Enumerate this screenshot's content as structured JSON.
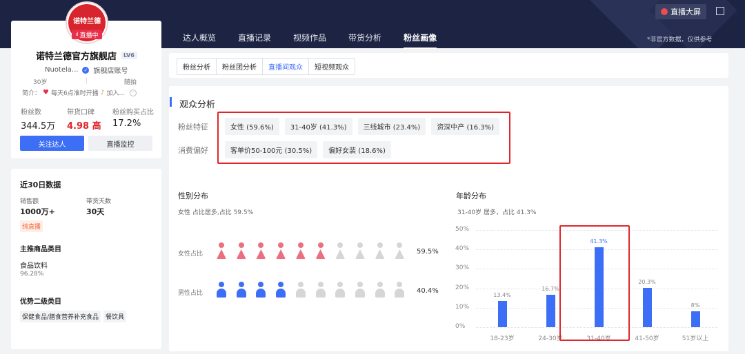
{
  "colors": {
    "primary": "#3d6ef6",
    "female": "#ec6f80",
    "male": "#3d6ef6",
    "inactive": "#d6d6d6",
    "highlight": "#e0262a"
  },
  "header": {
    "nav": [
      "达人概览",
      "直播记录",
      "视频作品",
      "带货分析",
      "粉丝画像"
    ],
    "active_nav": "粉丝画像",
    "live_screen_btn": "直播大屏",
    "disclaimer": "*非官方数据，仅供参考"
  },
  "profile": {
    "logo_text": "诺特兰德",
    "live_badge": "直播中",
    "name": "诺特兰德官方旗舰店",
    "level": "LV6",
    "handle": "Nuotela...",
    "verified": "旗舰店账号",
    "age": "30岁",
    "random": "随拍",
    "intro_label": "简介：",
    "intro_text": "每天6点准时开播",
    "intro_more": "加入...",
    "stats": [
      {
        "label": "粉丝数",
        "value": "344.5万"
      },
      {
        "label": "带货口碑",
        "value": "4.98 高"
      },
      {
        "label": "粉丝购买占比",
        "value": "17.2%"
      }
    ],
    "follow_btn": "关注达人",
    "monitor_btn": "直播监控"
  },
  "recent": {
    "title": "近30日数据",
    "sales_label": "销售额",
    "sales_value": "1000万+",
    "days_label": "带货天数",
    "days_value": "30天",
    "tag": "纯直播",
    "main_cat_title": "主推商品类目",
    "main_cat": "食品饮料",
    "main_cat_pct": "96.28%",
    "sub_cat_title": "优势二级类目",
    "sub_cats": [
      "保健食品/膳食营养补充食品",
      "餐饮具"
    ]
  },
  "subtabs": [
    "粉丝分析",
    "粉丝团分析",
    "直播间观众",
    "短视频观众"
  ],
  "active_subtab": "直播间观众",
  "audience": {
    "title": "观众分析",
    "feature_label": "粉丝特征",
    "features": [
      "女性 (59.6%)",
      "31-40岁 (41.3%)",
      "三线城市 (23.4%)",
      "资深中产 (16.3%)"
    ],
    "preference_label": "消费偏好",
    "preferences": [
      "客单价50-100元 (30.5%)",
      "偏好女装 (18.6%)"
    ]
  },
  "gender": {
    "title": "性别分布",
    "summary": "女性 占比居多,占比 59.5%",
    "female_label": "女性占比",
    "female_pct": "59.5%",
    "female_share": 0.595,
    "male_label": "男性占比",
    "male_pct": "40.4%",
    "male_share": 0.404
  },
  "age": {
    "title": "年龄分布",
    "summary": "31-40岁 居多，占比 41.3%"
  },
  "chart_data": {
    "type": "bar",
    "categories": [
      "18-23岁",
      "24-30岁",
      "31-40岁",
      "41-50岁",
      "51岁以上"
    ],
    "values": [
      13.4,
      16.7,
      41.3,
      20.3,
      8
    ],
    "value_labels": [
      "13.4%",
      "16.7%",
      "41.3%",
      "20.3%",
      "8%"
    ],
    "ylim": [
      0,
      50
    ],
    "yticks": [
      "0%",
      "10%",
      "20%",
      "30%",
      "40%",
      "50%"
    ],
    "highlight_category": "31-40岁",
    "grid": true
  }
}
